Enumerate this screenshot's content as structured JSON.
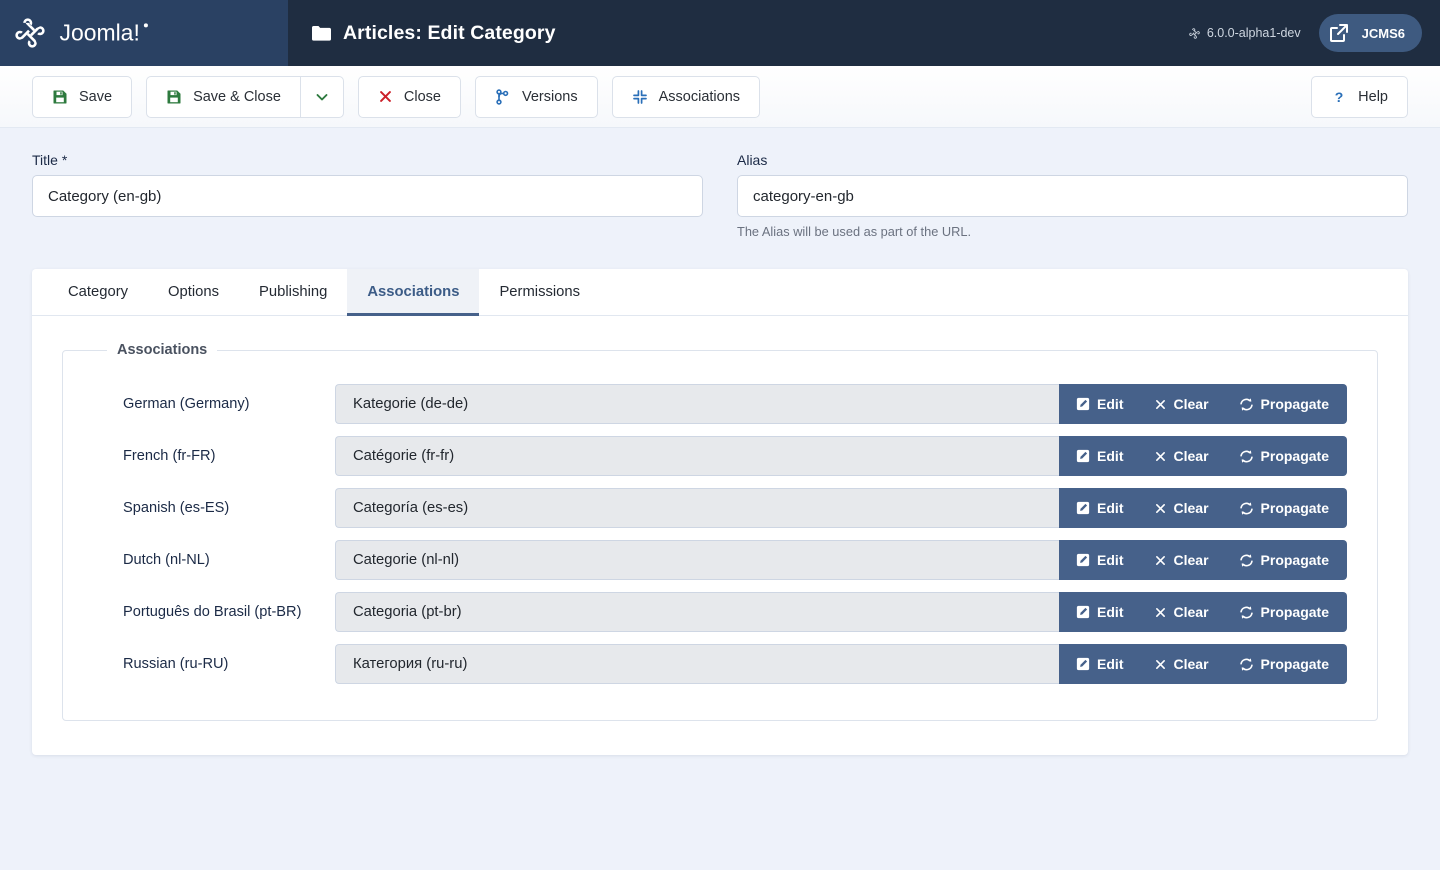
{
  "header": {
    "logo_alt": "Joomla!",
    "page_title": "Articles: Edit Category",
    "version": "6.0.0-alpha1-dev",
    "site_link_label": "JCMS6"
  },
  "toolbar": {
    "save": "Save",
    "save_close": "Save & Close",
    "close": "Close",
    "versions": "Versions",
    "associations": "Associations",
    "help": "Help"
  },
  "fields": {
    "title_label": "Title *",
    "title_value": "Category (en-gb)",
    "alias_label": "Alias",
    "alias_value": "category-en-gb",
    "alias_help": "The Alias will be used as part of the URL."
  },
  "tabs": [
    {
      "label": "Category",
      "active": false
    },
    {
      "label": "Options",
      "active": false
    },
    {
      "label": "Publishing",
      "active": false
    },
    {
      "label": "Associations",
      "active": true
    },
    {
      "label": "Permissions",
      "active": false
    }
  ],
  "associations": {
    "legend": "Associations",
    "buttons": {
      "edit": "Edit",
      "clear": "Clear",
      "propagate": "Propagate"
    },
    "rows": [
      {
        "language": "German (Germany)",
        "value": "Kategorie (de-de)"
      },
      {
        "language": "French (fr-FR)",
        "value": "Catégorie (fr-fr)"
      },
      {
        "language": "Spanish (es-ES)",
        "value": "Categoría (es-es)"
      },
      {
        "language": "Dutch (nl-NL)",
        "value": "Categorie (nl-nl)"
      },
      {
        "language": "Português do Brasil (pt-BR)",
        "value": "Categoria (pt-br)"
      },
      {
        "language": "Russian (ru-RU)",
        "value": "Категория (ru-ru)"
      }
    ]
  },
  "colors": {
    "header_left": "#2a4163",
    "header_right": "#1f2d41",
    "page_bg": "#eef2fa",
    "accent_blue": "#46618a",
    "save_green": "#2d7a3e",
    "close_red": "#cc2029",
    "link_blue": "#2a6fb8"
  }
}
